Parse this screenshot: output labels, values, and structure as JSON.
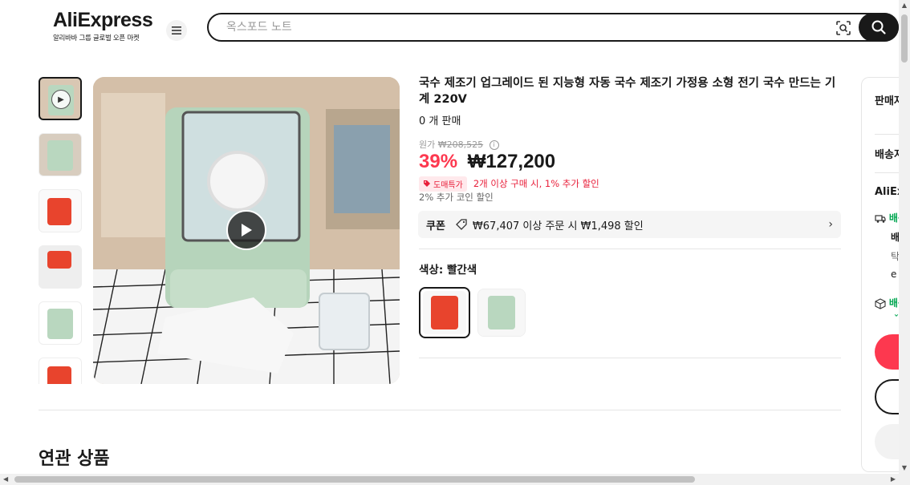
{
  "header": {
    "logo": "AliExpress",
    "logo_sub": "알리바바 그룹 글로벌 오픈 마켓",
    "menu_icon": "hamburger-icon",
    "search_placeholder": "옥스포드 노트",
    "lens_icon": "image-search-icon",
    "search_icon": "search-icon"
  },
  "gallery": {
    "thumbnails": [
      {
        "label": "video",
        "active": true
      },
      {
        "label": "green-front"
      },
      {
        "label": "red-with-vegetables"
      },
      {
        "label": "red-with-discs"
      },
      {
        "label": "green-side"
      },
      {
        "label": "red-front"
      }
    ]
  },
  "product": {
    "title": "국수 제조기 업그레이드 된 지능형 자동 국수 제조기 가정용 소형 전기 국수 만드는 기계 220V",
    "sold": "0 개 판매",
    "original_label": "원가",
    "original_price": "₩208,525",
    "discount": "39%",
    "price": "₩127,200",
    "wholesale_badge": "도매특가",
    "wholesale_text": "2개 이상 구매 시, 1% 추가 할인",
    "coin_text": "2% 추가 코인 할인",
    "coupon_label": "쿠폰",
    "coupon_text": "₩67,407 이상 주문 시 ₩1,498 할인",
    "color_label": "색상: 빨간색",
    "colors": [
      {
        "name": "빨간색",
        "color": "#e8442d",
        "selected": true
      },
      {
        "name": "초록색",
        "color": "#b9d7bf",
        "selected": false
      }
    ]
  },
  "related": {
    "title": "연관 상품"
  },
  "side": {
    "seller": "판매자",
    "shipping": "배송지",
    "ae": "AliExpress",
    "row1": "배송",
    "row2": "배송",
    "row3": "탁",
    "row4": "e",
    "row5": "배송",
    "row6": "ˇ"
  },
  "colors": {
    "accent": "#fd384f",
    "dark": "#191919",
    "green": "#00a650"
  }
}
